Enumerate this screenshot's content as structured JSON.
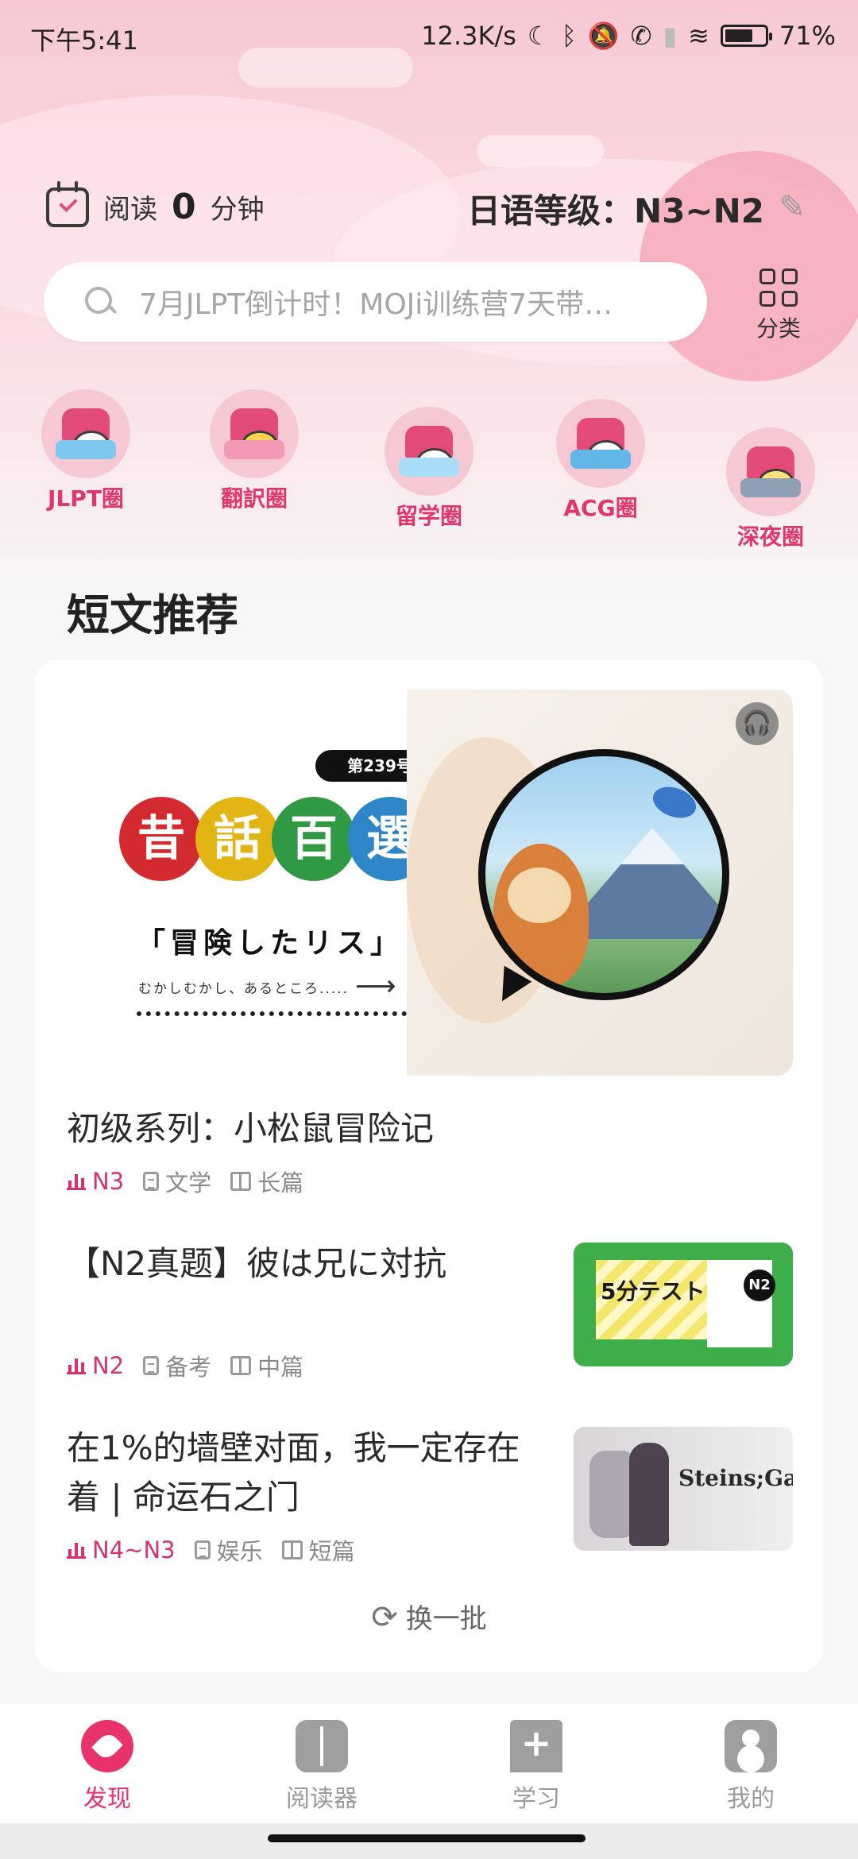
{
  "status_bar": {
    "time": "下午5:41",
    "net_speed": "12.3K/s",
    "battery": "71%",
    "battery_level": 0.71
  },
  "header": {
    "read_label": "阅读",
    "read_minutes": "0",
    "minute_unit": "分钟",
    "level_text": "日语等级：N3~N2"
  },
  "search": {
    "placeholder": "7月JLPT倒计时！MOJi训练营7天带…"
  },
  "category_label": "分类",
  "circles": [
    {
      "name": "JLPT圈"
    },
    {
      "name": "翻訳圈"
    },
    {
      "name": "留学圈"
    },
    {
      "name": "ACG圈"
    },
    {
      "name": "深夜圈"
    }
  ],
  "section_title": "短文推荐",
  "banner": {
    "issue": "第239号",
    "title_chars": [
      "昔",
      "話",
      "百",
      "選"
    ],
    "title_colors": [
      "#d22a2e",
      "#e2b414",
      "#2f9a43",
      "#2c86c7"
    ],
    "subtitle": "「冒険したリス」",
    "small_text": "むかしむかし、あるところ....."
  },
  "articles": [
    {
      "title": "初级系列：小松鼠冒险记",
      "level": "N3",
      "category": "文学",
      "length": "长篇"
    },
    {
      "title": "【N2真题】彼は兄に対抗",
      "level": "N2",
      "category": "备考",
      "length": "中篇",
      "thumb_title": "5分テスト",
      "thumb_badge": "N2"
    },
    {
      "title": "在1%的墙壁对面，我一定存在着 | 命运石之门",
      "level": "N4~N3",
      "category": "娱乐",
      "length": "短篇",
      "thumb_title": "Steins;Gate"
    }
  ],
  "refresh_label": "换一批",
  "bottom_nav": [
    {
      "label": "发现",
      "active": true
    },
    {
      "label": "阅读器",
      "active": false
    },
    {
      "label": "学习",
      "active": false
    },
    {
      "label": "我的",
      "active": false
    }
  ],
  "colors": {
    "accent": "#e8326c",
    "level_pink": "#d6336c"
  }
}
